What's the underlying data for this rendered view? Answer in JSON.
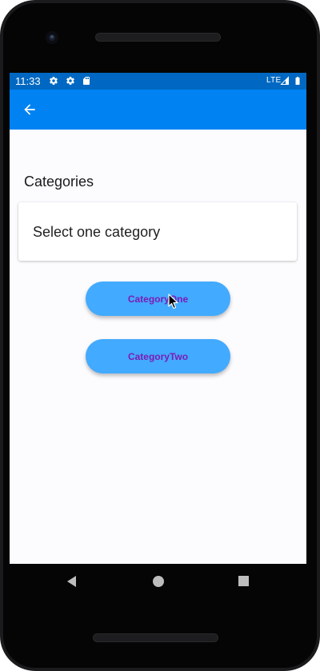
{
  "status_bar": {
    "time": "11:33",
    "network": "LTE",
    "icons": [
      "settings-icon",
      "settings-icon",
      "sd-card-icon",
      "signal-icon",
      "battery-icon"
    ]
  },
  "app_bar": {
    "back_icon": "arrow-back-icon"
  },
  "content": {
    "section_title": "Categories",
    "card_text": "Select one category",
    "buttons": [
      {
        "label": "CategoryOne"
      },
      {
        "label": "CategoryTwo"
      }
    ]
  },
  "nav_bar": {
    "icons": [
      "back-triangle-icon",
      "home-circle-icon",
      "recents-square-icon"
    ]
  },
  "colors": {
    "status_bar": "#0068c2",
    "app_bar": "#0082f2",
    "button_bg": "#42aaff",
    "button_text": "#7d1bb5",
    "background": "#fcfbfe"
  }
}
